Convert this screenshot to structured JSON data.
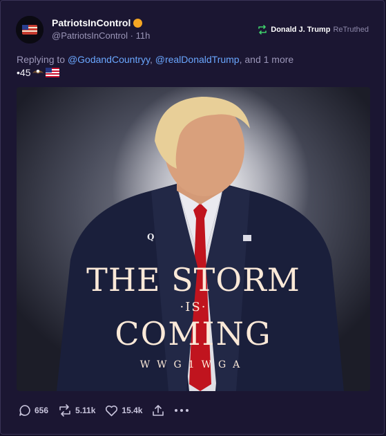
{
  "post": {
    "display_name": "PatriotsInControl",
    "handle": "@PatriotsInControl",
    "time_sep": " · ",
    "time": "11h",
    "retruth_by": "Donald J. Trump",
    "retruth_label": "ReTruthed",
    "reply_prefix": "Replying to ",
    "mentions": [
      "@GodandCountryy",
      "@realDonaldTrump"
    ],
    "reply_suffix": ", and 1 more",
    "text": "•45",
    "image_text": {
      "title": "THE STORM",
      "is": "·IS·",
      "coming": "COMING",
      "tag": "WWG1WGA",
      "q_pin": "Q"
    }
  },
  "actions": {
    "replies": "656",
    "retruths": "5.11k",
    "likes": "15.4k",
    "share_icon": "share-icon",
    "more_icon": "more-icon"
  },
  "colors": {
    "background": "#1b1632",
    "mention": "#6aa7ff",
    "verified": "#f5a623",
    "retruth": "#3ecf6b"
  }
}
